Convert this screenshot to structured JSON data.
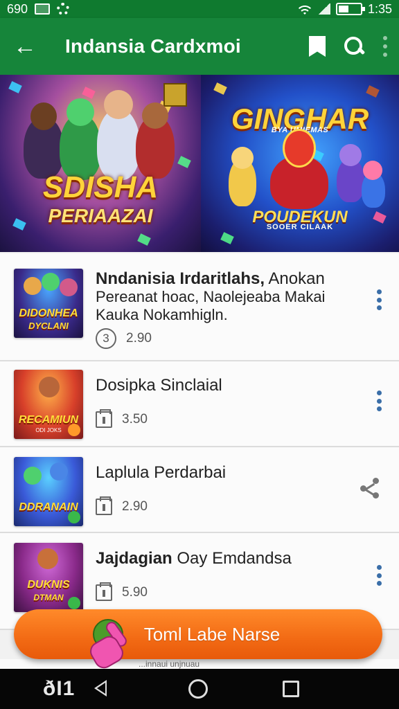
{
  "status_bar": {
    "left_text": "690",
    "left_icons": [
      "notification-box-icon",
      "settings-gear-icon"
    ],
    "time": "1:35",
    "right_icons": [
      "wifi-icon",
      "signal-icon",
      "battery-icon"
    ]
  },
  "app_bar": {
    "title": "Indansia Cardxmoi",
    "icons": [
      "back-arrow-icon",
      "bookmark-icon",
      "search-icon",
      "overflow-menu-icon"
    ],
    "color": "#16853a"
  },
  "banner": {
    "left": {
      "title": "SDISHA",
      "subtitle": "PERIAAZAI"
    },
    "right": {
      "title": "GINGHAR",
      "tagline": "BYA UMIEMAS",
      "subtitle": "POUDEKUN",
      "caption": "SOOER CILAAK"
    }
  },
  "list": {
    "items": [
      {
        "thumb_title": "DIDONHEA",
        "thumb_sub": "DYCLANI",
        "title_bold": "Nndanisia Irdaritlahs,",
        "title_rest": " Anokan",
        "description": "Pereanat hoac, Naolejeaba Makai Kauka Nokamhigln.",
        "meta_value": "2.90",
        "meta_icon_text": "3",
        "action_icon": "overflow-menu-icon"
      },
      {
        "thumb_title": "RECAMIUN",
        "thumb_sub": "ODI JOKS",
        "title_bold": "",
        "title_rest": "Dosipka Sinclaial",
        "description": "",
        "meta_value": "3.50",
        "action_icon": "overflow-menu-icon"
      },
      {
        "thumb_title": "DDRANAIN",
        "thumb_sub": "",
        "title_bold": "",
        "title_rest": "Laplula Perdarbai",
        "description": "",
        "meta_value": "2.90",
        "action_icon": "share-icon"
      },
      {
        "thumb_title": "DUKNIS",
        "thumb_sub": "DTMAN",
        "title_bold": "Jajdagian",
        "title_rest": " Oay Emdandsa",
        "description": "",
        "meta_value": "5.90",
        "action_icon": "overflow-menu-icon"
      }
    ]
  },
  "fab": {
    "label": "Toml Labe Narse",
    "color": "#f26a14"
  },
  "peek_text": "...innaui unjnuau",
  "nav_bar": {
    "left_text": "ðI1",
    "icons": [
      "back-triangle-icon",
      "home-circle-icon",
      "recents-square-icon"
    ]
  }
}
